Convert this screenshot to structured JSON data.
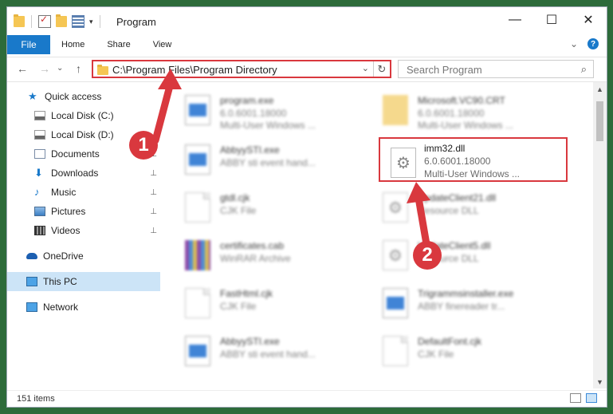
{
  "window": {
    "title": "Program"
  },
  "window_controls": {
    "minimize": "—",
    "maximize": "☐",
    "close": "✕"
  },
  "ribbon": {
    "tabs": [
      {
        "label": "File",
        "active": true
      },
      {
        "label": "Home"
      },
      {
        "label": "Share"
      },
      {
        "label": "View"
      }
    ],
    "collapse_chevron": "⌄",
    "help": "?"
  },
  "nav": {
    "back": "←",
    "forward": "→",
    "recent": "⌄",
    "up": "↑",
    "address": "C:\\Program Files\\Program Directory",
    "address_dropdown": "⌄",
    "refresh": "↻",
    "search_placeholder": "Search Program",
    "search_icon": "⌕"
  },
  "sidebar": {
    "items": [
      {
        "label": "Quick access",
        "icon": "star-icon",
        "pinned": false
      },
      {
        "label": "Local Disk (C:)",
        "icon": "drive-icon",
        "pinned": false
      },
      {
        "label": "Local Disk (D:)",
        "icon": "drive-icon",
        "pinned": false
      },
      {
        "label": "Documents",
        "icon": "documents-icon",
        "pinned": true
      },
      {
        "label": "Downloads",
        "icon": "downloads-icon",
        "pinned": true
      },
      {
        "label": "Music",
        "icon": "music-icon",
        "pinned": true
      },
      {
        "label": "Pictures",
        "icon": "pictures-icon",
        "pinned": true
      },
      {
        "label": "Videos",
        "icon": "videos-icon",
        "pinned": true
      },
      {
        "label": "OneDrive",
        "icon": "cloud-icon",
        "pinned": false
      },
      {
        "label": "This PC",
        "icon": "computer-icon",
        "pinned": false,
        "selected": true
      },
      {
        "label": "Network",
        "icon": "network-icon",
        "pinned": false
      }
    ],
    "pin_glyph": "📌"
  },
  "files": [
    {
      "name": "program.exe",
      "line1": "6.0.6001.18000",
      "line2": "Multi-User Windows ...",
      "icon": "exe-icon"
    },
    {
      "name": "Microsoft.VC90.CRT",
      "line1": "6.0.6001.18000",
      "line2": "Multi-User Windows ...",
      "icon": "folder-icon"
    },
    {
      "name": "AbbyySTI.exe",
      "line1": "ABBY sti event hand...",
      "line2": "",
      "icon": "exe-icon"
    },
    {
      "name": "imm32.dll",
      "line1": "6.0.6001.18000",
      "line2": "Multi-User Windows ...",
      "icon": "dll-gear-icon",
      "highlighted": true
    },
    {
      "name": "gtdl.cjk",
      "line1": "CJK File",
      "line2": "",
      "icon": "document-icon"
    },
    {
      "name": "UpdateClient21.dll",
      "line1": "Resource DLL",
      "line2": "",
      "icon": "dll-gear-icon"
    },
    {
      "name": "certificates.cab",
      "line1": "WinRAR Archive",
      "line2": "",
      "icon": "archive-icon"
    },
    {
      "name": "UpdateClient5.dll",
      "line1": "Resource DLL",
      "line2": "",
      "icon": "dll-gear-icon"
    },
    {
      "name": "FastHtml.cjk",
      "line1": "CJK File",
      "line2": "",
      "icon": "document-icon"
    },
    {
      "name": "Trigrammsinstaller.exe",
      "line1": "ABBY finereader tr...",
      "line2": "",
      "icon": "exe-icon"
    },
    {
      "name": "AbbyySTI.exe",
      "line1": "ABBY sti event hand...",
      "line2": "",
      "icon": "exe-icon"
    },
    {
      "name": "DefaultFont.cjk",
      "line1": "CJK File",
      "line2": "",
      "icon": "document-icon"
    }
  ],
  "status": {
    "count": "151 items"
  },
  "callouts": {
    "one": "1",
    "two": "2"
  },
  "colors": {
    "accent": "#1979ca",
    "annotation": "#d9383e",
    "selected": "#cce4f7"
  }
}
